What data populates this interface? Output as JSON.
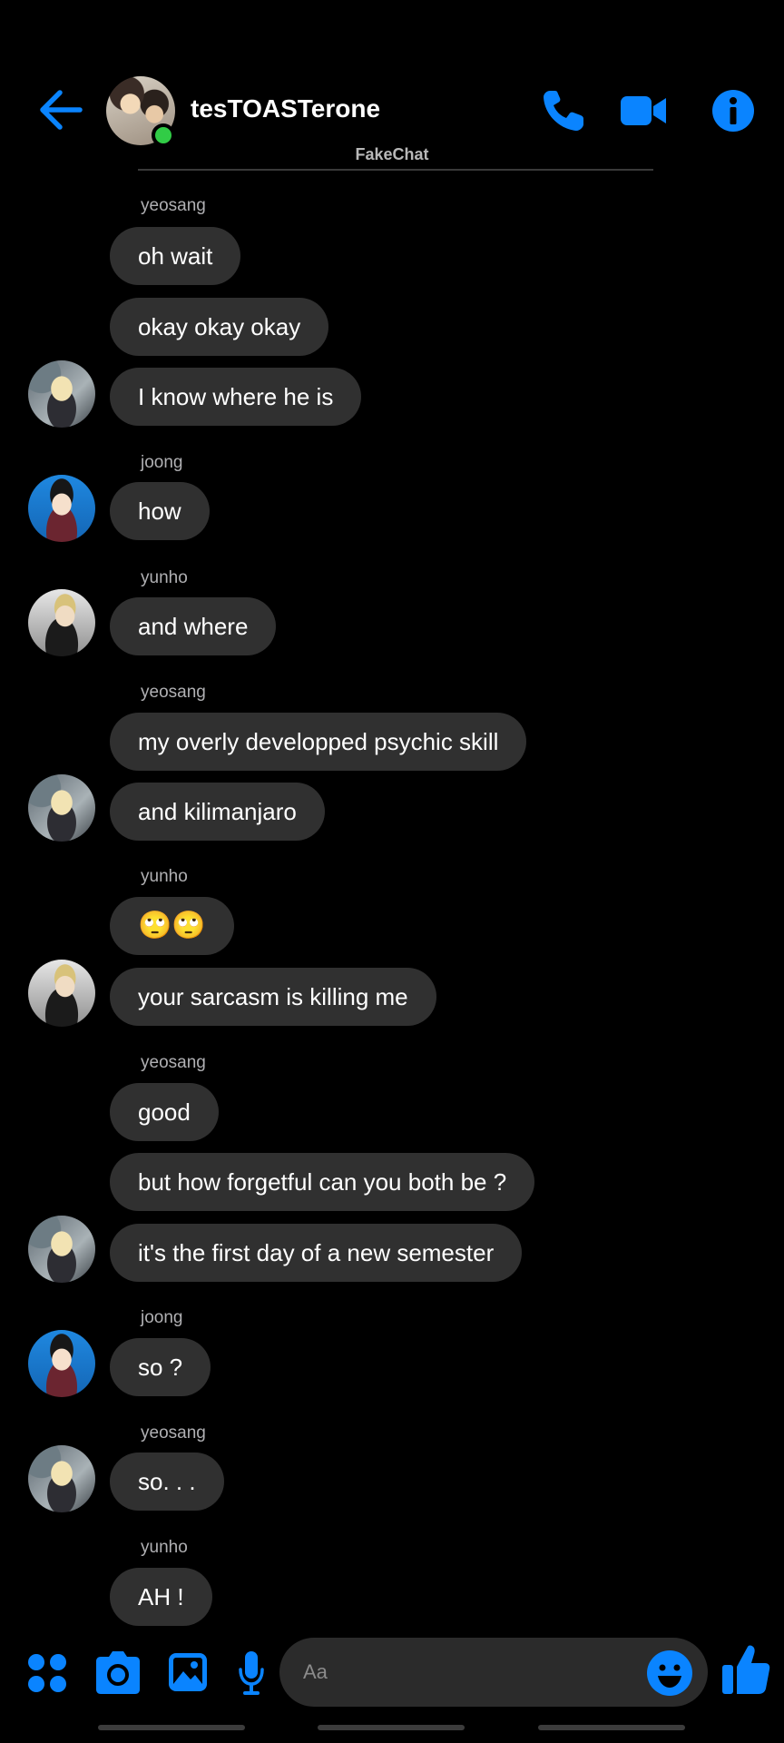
{
  "header": {
    "title": "tesTOASTerone",
    "watermark": "FakeChat",
    "accent_color": "#0a84ff",
    "online_color": "#31cc46"
  },
  "messages": [
    {
      "sender": "yeosang",
      "text": "oh wait"
    },
    {
      "text": "okay okay okay"
    },
    {
      "text": "I know where he is",
      "avatar": "yeosang"
    },
    {
      "sender": "joong",
      "text": "how",
      "avatar": "joong"
    },
    {
      "sender": "yunho",
      "text": "and where",
      "avatar": "yunho"
    },
    {
      "sender": "yeosang",
      "text": "my overly developped psychic skill"
    },
    {
      "text": "and kilimanjaro",
      "avatar": "yeosang"
    },
    {
      "sender": "yunho",
      "text": "🙄🙄"
    },
    {
      "text": "your sarcasm is killing me",
      "avatar": "yunho"
    },
    {
      "sender": "yeosang",
      "text": "good"
    },
    {
      "text": "but how forgetful can you both be ?"
    },
    {
      "text": "it's the first day of a new semester",
      "avatar": "yeosang"
    },
    {
      "sender": "joong",
      "text": "so ?",
      "avatar": "joong"
    },
    {
      "sender": "yeosang",
      "text": "so. . .",
      "avatar": "yeosang"
    },
    {
      "sender": "yunho",
      "text": "AH !"
    }
  ],
  "composer": {
    "placeholder": "Aa",
    "icons": [
      "apps-icon",
      "camera-icon",
      "gallery-icon",
      "microphone-icon",
      "emoji-icon",
      "thumbs-up-icon"
    ]
  },
  "header_icons": [
    "back-arrow-icon",
    "phone-call-icon",
    "video-call-icon",
    "info-icon"
  ]
}
